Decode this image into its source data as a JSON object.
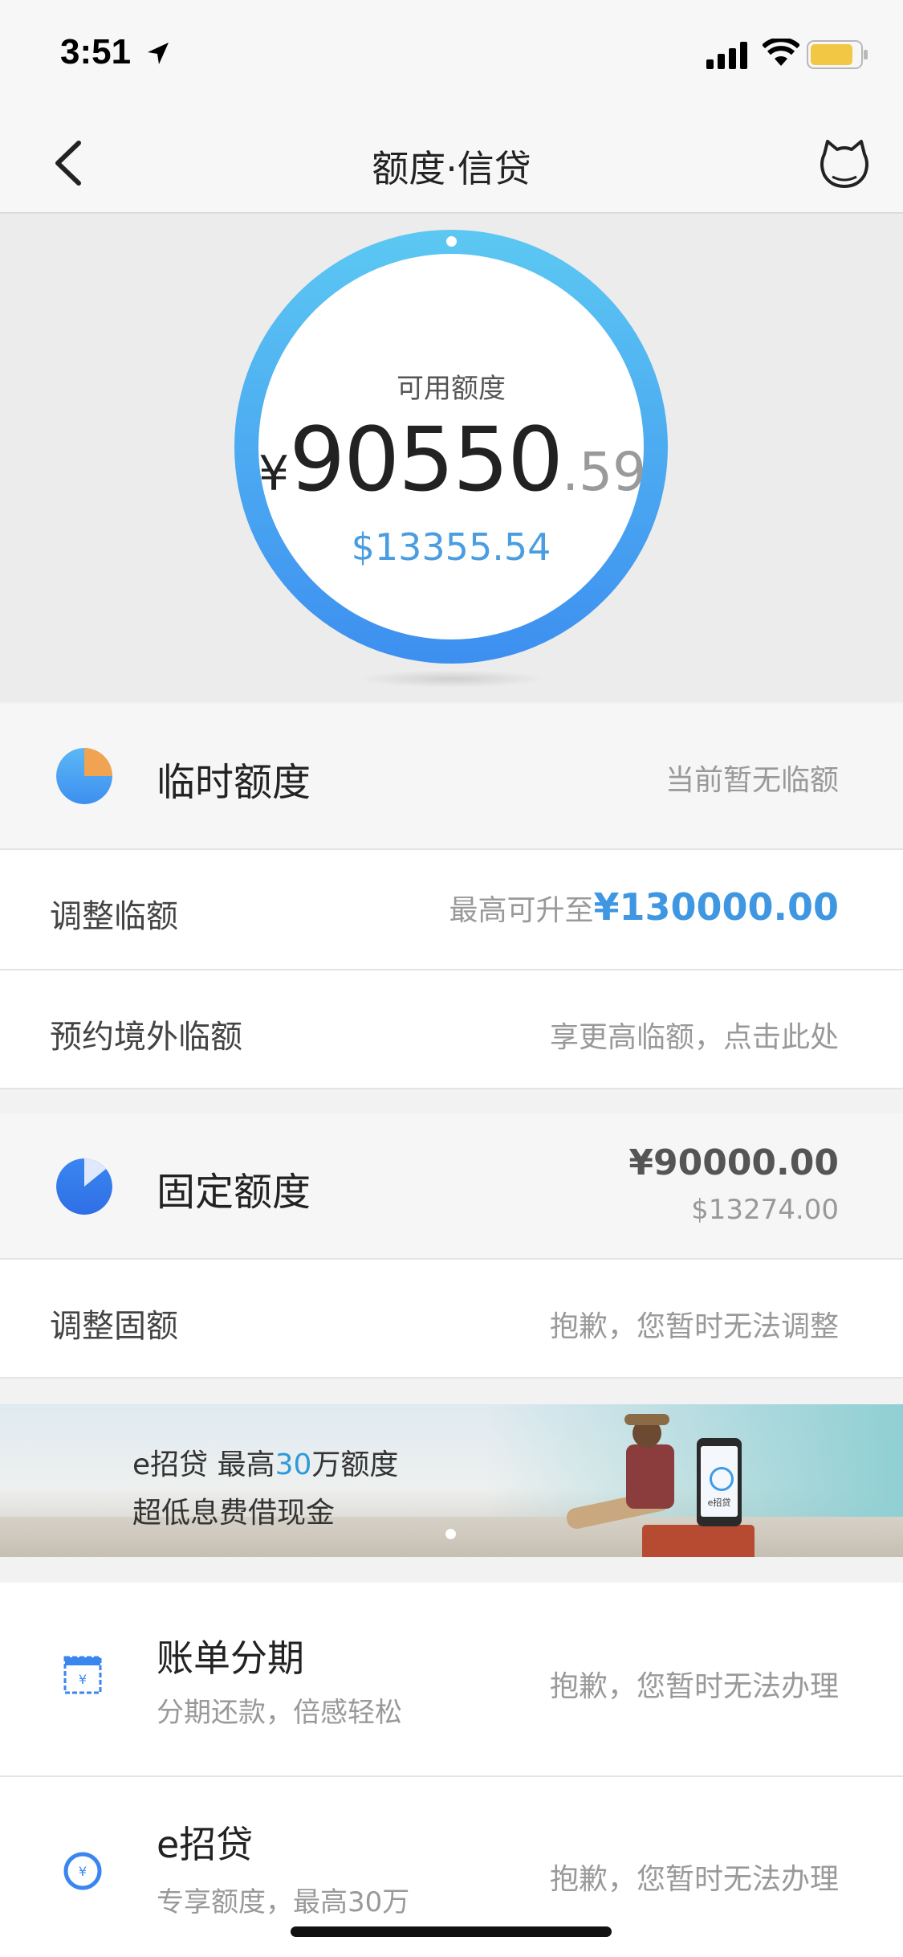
{
  "status_bar": {
    "time": "3:51"
  },
  "nav": {
    "title": "额度·信贷"
  },
  "hero": {
    "label": "可用额度",
    "currency_symbol": "¥",
    "amount_int": "90550",
    "amount_dec": ".59",
    "usd": "$13355.54"
  },
  "temp_limit": {
    "title": "临时额度",
    "status": "当前暂无临额",
    "rows": [
      {
        "label": "调整临额",
        "prefix": "最高可升至",
        "highlight": "¥130000.00"
      },
      {
        "label": "预约境外临额",
        "value": "享更高临额，点击此处"
      }
    ]
  },
  "fixed_limit": {
    "title": "固定额度",
    "cny": "¥90000.00",
    "usd": "$13274.00",
    "rows": [
      {
        "label": "调整固额",
        "value": "抱歉，您暂时无法调整"
      }
    ]
  },
  "banner": {
    "line1_a": "e招贷  最高",
    "line1_num": "30",
    "line1_b": "万额度",
    "line2": "超低息费借现金",
    "phone_label": "e招贷"
  },
  "services": [
    {
      "title": "账单分期",
      "subtitle": "分期还款，倍感轻松",
      "status": "抱歉，您暂时无法办理",
      "icon": "bill-installment-icon"
    },
    {
      "title": "e招贷",
      "subtitle": "专享额度，最高30万",
      "status": "抱歉，您暂时无法办理",
      "icon": "loan-coin-icon"
    }
  ],
  "colors": {
    "accent": "#3f97e2",
    "ring_top": "#5cc8f2",
    "ring_bottom": "#3d8ff0",
    "temp_pie": "#f0a350",
    "fixed_pie": "#2f6fe6"
  }
}
